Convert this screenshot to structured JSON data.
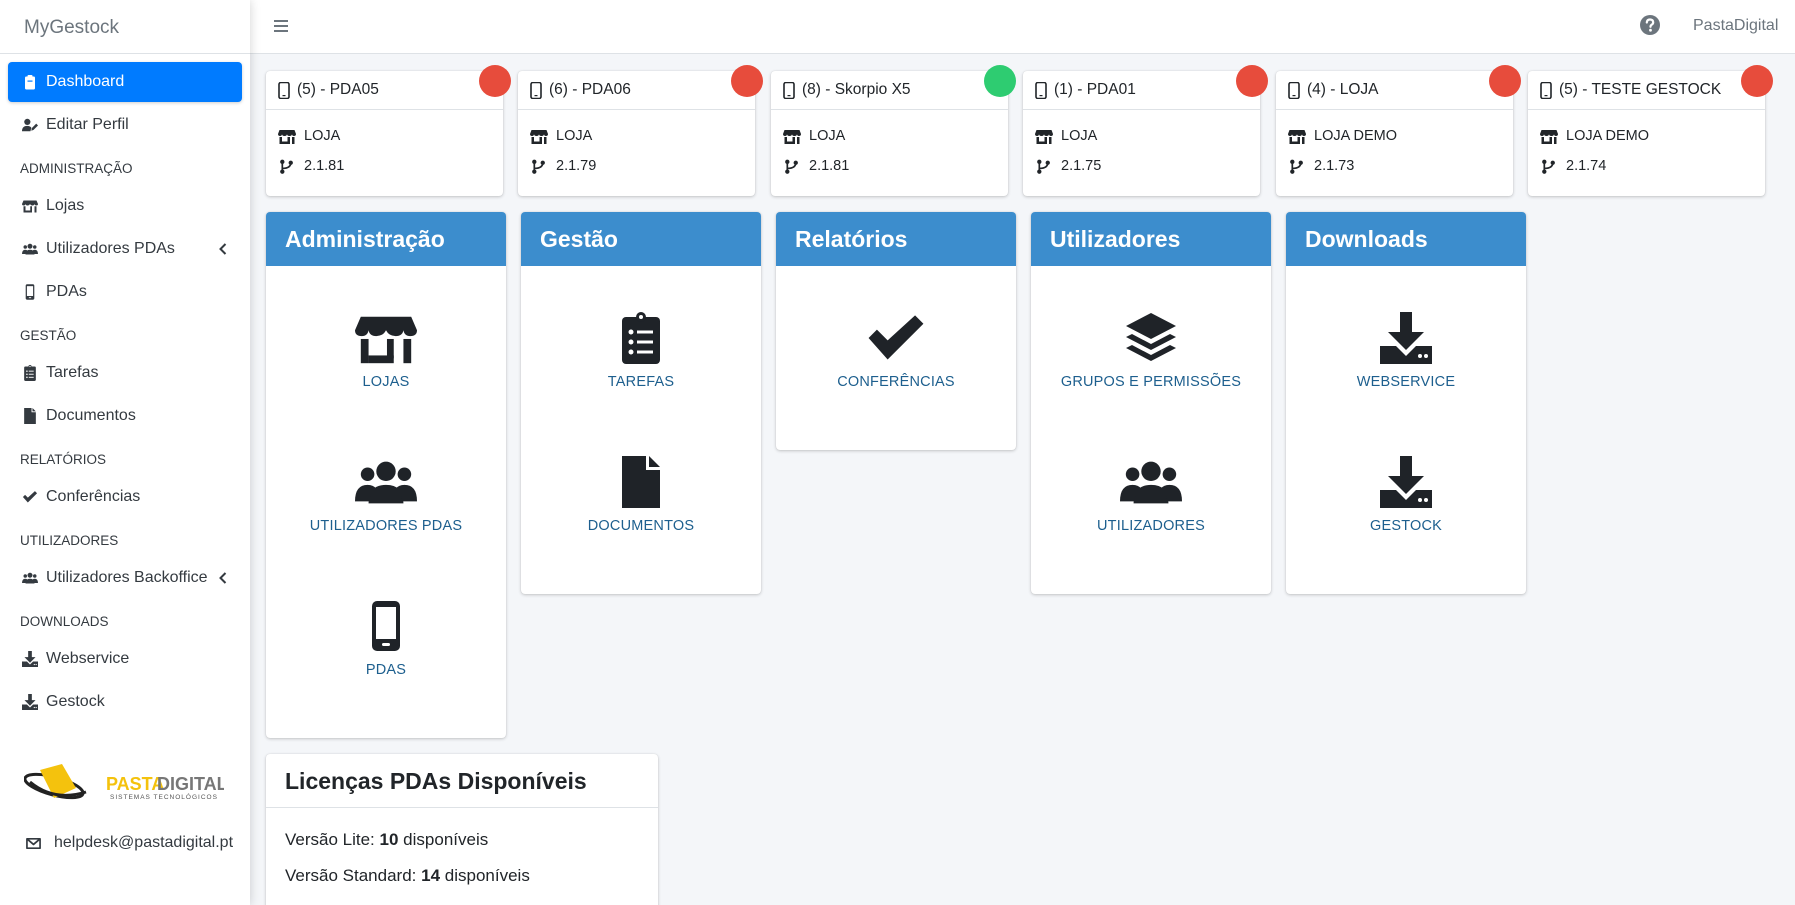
{
  "brand": "MyGestock",
  "sidebar": {
    "items": [
      {
        "type": "item",
        "label": "Dashboard",
        "icon": "clipboard-icon",
        "active": true
      },
      {
        "type": "item",
        "label": "Editar Perfil",
        "icon": "user-edit-icon"
      },
      {
        "type": "header",
        "label": "ADMINISTRAÇÃO"
      },
      {
        "type": "item",
        "label": "Lojas",
        "icon": "store-icon"
      },
      {
        "type": "item",
        "label": "Utilizadores PDAs",
        "icon": "users-icon",
        "caret": true
      },
      {
        "type": "item",
        "label": "PDAs",
        "icon": "mobile-icon"
      },
      {
        "type": "header",
        "label": "GESTÃO"
      },
      {
        "type": "item",
        "label": "Tarefas",
        "icon": "tasks-icon"
      },
      {
        "type": "item",
        "label": "Documentos",
        "icon": "file-icon"
      },
      {
        "type": "header",
        "label": "RELATÓRIOS"
      },
      {
        "type": "item",
        "label": "Conferências",
        "icon": "check-icon"
      },
      {
        "type": "header",
        "label": "UTILIZADORES"
      },
      {
        "type": "item",
        "label": "Utilizadores Backoffice",
        "icon": "users-icon",
        "caret": true
      },
      {
        "type": "header",
        "label": "DOWNLOADS"
      },
      {
        "type": "item",
        "label": "Webservice",
        "icon": "download-icon"
      },
      {
        "type": "item",
        "label": "Gestock",
        "icon": "download-icon"
      }
    ],
    "logo_text": {
      "pasta": "PASTA",
      "digital": "DIGITAL",
      "tagline": "SISTEMAS TECNOLÓGICOS"
    },
    "helpdesk": "helpdesk@pastadigital.pt"
  },
  "topbar": {
    "user": "PastaDigital"
  },
  "colors": {
    "primary": "#007bff",
    "module_header": "#3c8dcd",
    "offline": "#e74c3c",
    "online": "#2ecc71",
    "link": "#1d5f8e"
  },
  "devices": [
    {
      "name": "(5) - PDA05",
      "store": "LOJA",
      "version": "2.1.81",
      "status": "offline"
    },
    {
      "name": "(6) - PDA06",
      "store": "LOJA",
      "version": "2.1.79",
      "status": "offline"
    },
    {
      "name": "(8) - Skorpio X5",
      "store": "LOJA",
      "version": "2.1.81",
      "status": "online"
    },
    {
      "name": "(1) - PDA01",
      "store": "LOJA",
      "version": "2.1.75",
      "status": "offline"
    },
    {
      "name": "(4) - LOJA",
      "store": "LOJA DEMO",
      "version": "2.1.73",
      "status": "offline"
    },
    {
      "name": "(5) - TESTE GESTOCK",
      "store": "LOJA DEMO",
      "version": "2.1.74",
      "status": "offline"
    }
  ],
  "modules": [
    {
      "title": "Administração",
      "items": [
        {
          "label": "LOJAS",
          "icon": "store-icon"
        },
        {
          "label": "UTILIZADORES PDAS",
          "icon": "users-icon"
        },
        {
          "label": "PDAS",
          "icon": "mobile-icon"
        }
      ]
    },
    {
      "title": "Gestão",
      "items": [
        {
          "label": "TAREFAS",
          "icon": "tasks-icon"
        },
        {
          "label": "DOCUMENTOS",
          "icon": "file-icon"
        }
      ]
    },
    {
      "title": "Relatórios",
      "items": [
        {
          "label": "CONFERÊNCIAS",
          "icon": "check-icon"
        }
      ]
    },
    {
      "title": "Utilizadores",
      "items": [
        {
          "label": "GRUPOS E PERMISSÕES",
          "icon": "layers-icon"
        },
        {
          "label": "UTILIZADORES",
          "icon": "users-icon"
        }
      ]
    },
    {
      "title": "Downloads",
      "items": [
        {
          "label": "WEBSERVICE",
          "icon": "download-icon"
        },
        {
          "label": "GESTOCK",
          "icon": "download-icon"
        }
      ]
    }
  ],
  "licences": {
    "title": "Licenças PDAs Disponíveis",
    "lite": {
      "prefix": "Versão Lite:",
      "count": "10",
      "suffix": "disponíveis"
    },
    "standard": {
      "prefix": "Versão Standard:",
      "count": "14",
      "suffix": "disponíveis"
    }
  }
}
